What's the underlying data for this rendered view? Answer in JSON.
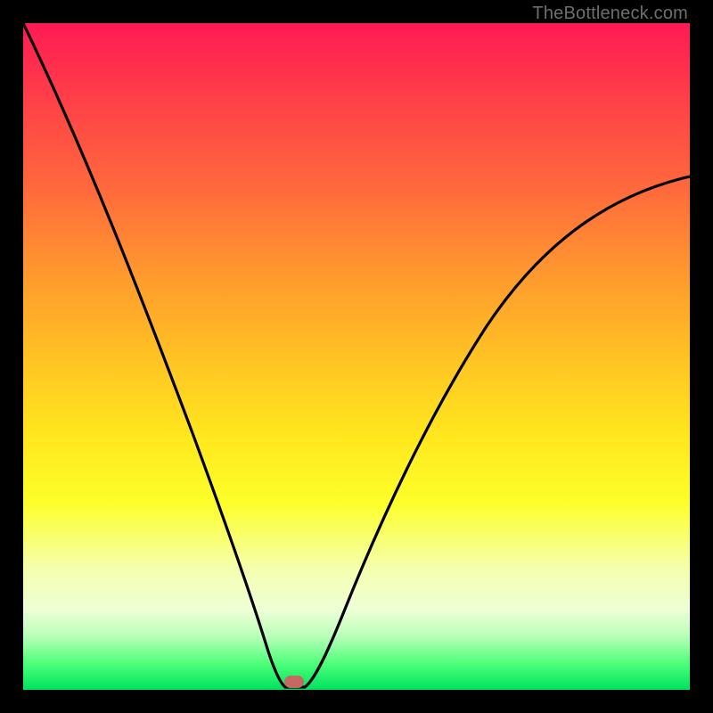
{
  "watermark": "TheBottleneck.com",
  "chart_data": {
    "type": "line",
    "title": "",
    "xlabel": "",
    "ylabel": "",
    "xlim": [
      0,
      100
    ],
    "ylim": [
      0,
      100
    ],
    "grid": false,
    "legend": false,
    "series": [
      {
        "name": "curve",
        "x": [
          0,
          4,
          8,
          12,
          16,
          20,
          24,
          28,
          31,
          33,
          35,
          37,
          38,
          40,
          42,
          44,
          46,
          50,
          55,
          60,
          65,
          70,
          75,
          80,
          85,
          90,
          95,
          100
        ],
        "y": [
          100,
          91,
          82,
          73,
          64,
          55,
          45,
          34,
          24,
          17,
          10,
          4,
          1,
          0,
          0,
          2,
          6,
          14,
          24,
          33,
          41,
          48,
          54,
          60,
          65,
          69,
          73,
          77
        ]
      }
    ],
    "marker": {
      "x": 40.5,
      "y": 1.2
    },
    "background_gradient": {
      "top": "#ff1a54",
      "mid": "#ffe71e",
      "bottom": "#00e25f"
    },
    "flat_bottom_range_x": [
      38,
      42
    ]
  }
}
